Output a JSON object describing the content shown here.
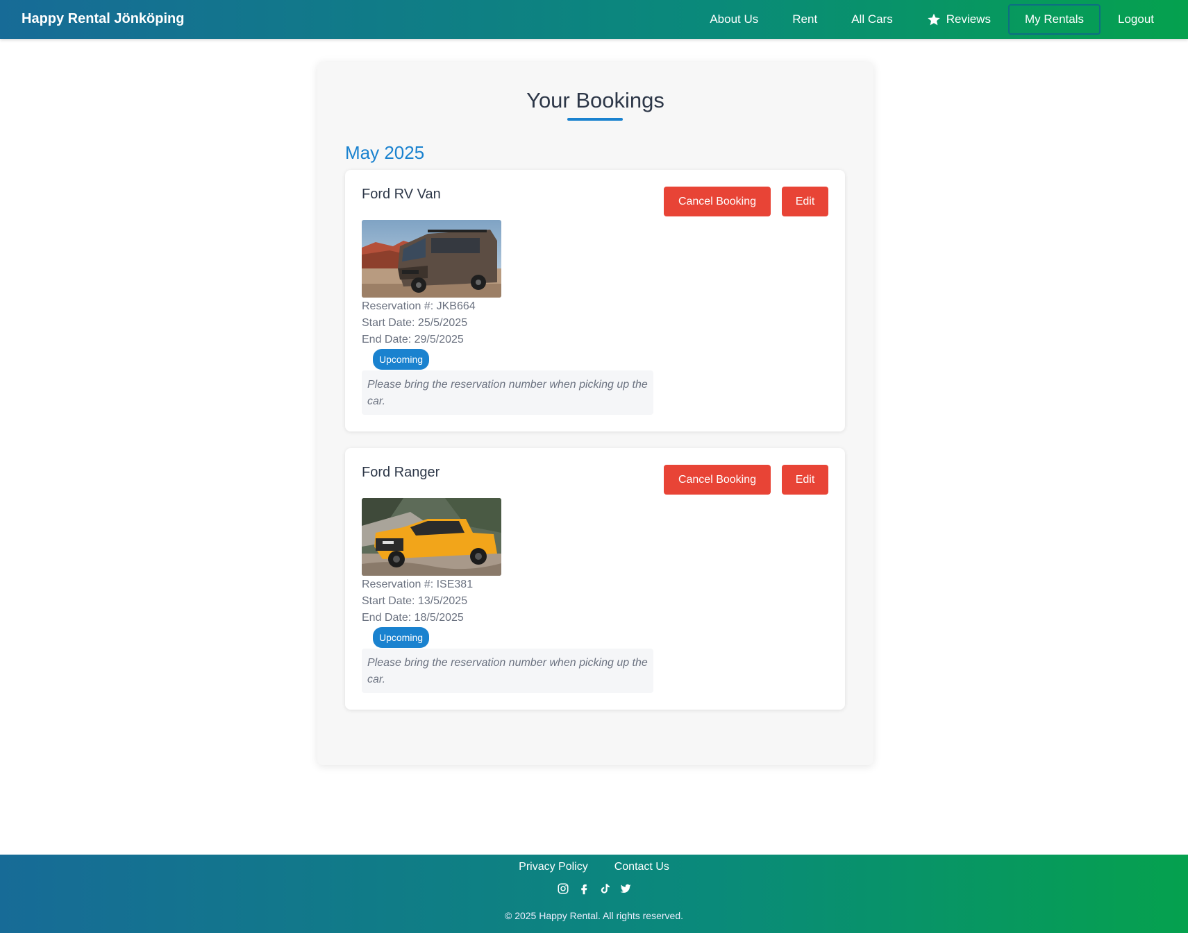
{
  "navbar": {
    "brand": "Happy Rental Jönköping",
    "links": [
      "About Us",
      "Rent",
      "All Cars",
      "Reviews",
      "My Rentals",
      "Logout"
    ],
    "active_link": "My Rentals"
  },
  "page": {
    "title": "Your Bookings",
    "month": "May 2025"
  },
  "bookings": [
    {
      "car": "Ford RV Van",
      "image": "ford-rv-van-photo",
      "reservation": "Reservation #: JKB664",
      "start": "Start Date: 25/5/2025",
      "end": "End Date: 29/5/2025",
      "status": "Upcoming",
      "note": "Please bring the reservation number when picking up the car.",
      "cancel_label": "Cancel Booking",
      "edit_label": "Edit"
    },
    {
      "car": "Ford Ranger",
      "image": "ford-ranger-photo",
      "reservation": "Reservation #: ISE381",
      "start": "Start Date: 13/5/2025",
      "end": "End Date: 18/5/2025",
      "status": "Upcoming",
      "note": "Please bring the reservation number when picking up the car.",
      "cancel_label": "Cancel Booking",
      "edit_label": "Edit"
    }
  ],
  "footer": {
    "links": [
      "Privacy Policy",
      "Contact Us"
    ],
    "social_icons": [
      "instagram-icon",
      "facebook-icon",
      "tiktok-icon",
      "twitter-icon"
    ],
    "copyright": "© 2025 Happy Rental. All rights reserved."
  },
  "colors": {
    "accent": "#1a82cf",
    "danger": "#e84436",
    "gradient_start": "#176b97",
    "gradient_end": "#05a14e"
  }
}
